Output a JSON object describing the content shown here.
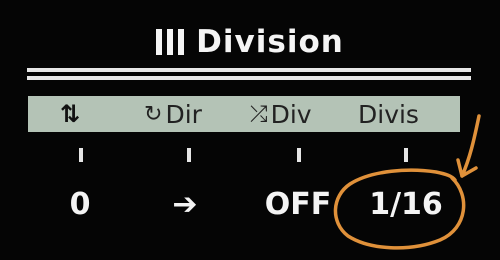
{
  "header": {
    "title": "Division",
    "menu_icon": "menu-bars-icon"
  },
  "param_bar": {
    "swap_icon": "⇅",
    "items": [
      {
        "icon": "cycle-direction-icon",
        "glyph": "↻",
        "label": "Dir"
      },
      {
        "icon": "shuffle-icon",
        "glyph": "⤮",
        "label": "Div"
      },
      {
        "icon": "",
        "glyph": "",
        "label": "Divis"
      }
    ]
  },
  "values": [
    "0",
    "➔",
    "OFF",
    "1/16"
  ],
  "colors": {
    "bar_bg": "#b4c3b6",
    "annotation": "#e0913a",
    "background": "#050505"
  }
}
